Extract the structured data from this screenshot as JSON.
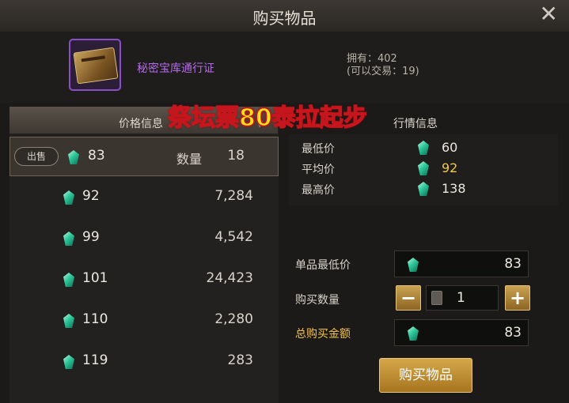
{
  "window": {
    "title": "购买物品"
  },
  "item": {
    "name": "秘密宝库通行证",
    "owned": "拥有：402",
    "tradable": "(可以交易：19)"
  },
  "promo_text": "祭坛票80泰拉起步",
  "price_tab": {
    "label": "价格信息"
  },
  "market_tab": {
    "label": "行情信息"
  },
  "listings": [
    {
      "sell_label": "出售",
      "price": "83",
      "qty_label": "数量",
      "qty": "18"
    },
    {
      "price": "92",
      "qty": "7,284"
    },
    {
      "price": "99",
      "qty": "4,542"
    },
    {
      "price": "101",
      "qty": "24,423"
    },
    {
      "price": "110",
      "qty": "2,280"
    },
    {
      "price": "119",
      "qty": "283"
    }
  ],
  "stats": [
    {
      "label": "最低价",
      "value": "60"
    },
    {
      "label": "平均价",
      "value": "92"
    },
    {
      "label": "最高价",
      "value": "138"
    }
  ],
  "form": {
    "min_price_label": "单品最低价",
    "min_price": "83",
    "qty_label": "购买数量",
    "qty": "1",
    "total_label": "总购买金额",
    "total": "83"
  },
  "buy_button": "购买物品",
  "colors": {
    "gem": "#2ec79b",
    "accent_gold": "#f0c14a",
    "item_purple": "#b46ae8",
    "promo_text": "#ffe21a",
    "promo_stroke": "#c4161c"
  }
}
